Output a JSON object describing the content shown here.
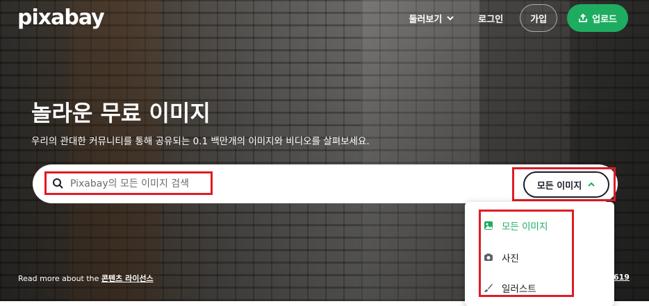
{
  "header": {
    "logo": "pixabay",
    "nav": {
      "explore_label": "둘러보기",
      "login_label": "로그인",
      "signup_label": "가입",
      "upload_label": "업로드"
    }
  },
  "hero": {
    "title": "놀라운 무료 이미지",
    "subtitle": "우리의 관대한 커뮤니티를 통해 공유되는 0.1 백만개의 이미지와 비디오를 살펴보세요."
  },
  "search": {
    "placeholder": "Pixabay의 모든 이미지 검색",
    "filter_label": "모든 이미지"
  },
  "dropdown": {
    "items": [
      {
        "label": "모든 이미지",
        "icon": "image-icon",
        "selected": true
      },
      {
        "label": "사진",
        "icon": "camera-icon",
        "selected": false
      },
      {
        "label": "일러스트",
        "icon": "brush-icon",
        "selected": false
      }
    ]
  },
  "footer": {
    "prefix": "Read more about the",
    "license_link": "콘텐츠 라이선스",
    "credit": "619"
  },
  "colors": {
    "accent": "#1ead60",
    "highlight": "#e01b24",
    "dark_text": "#191b26"
  }
}
